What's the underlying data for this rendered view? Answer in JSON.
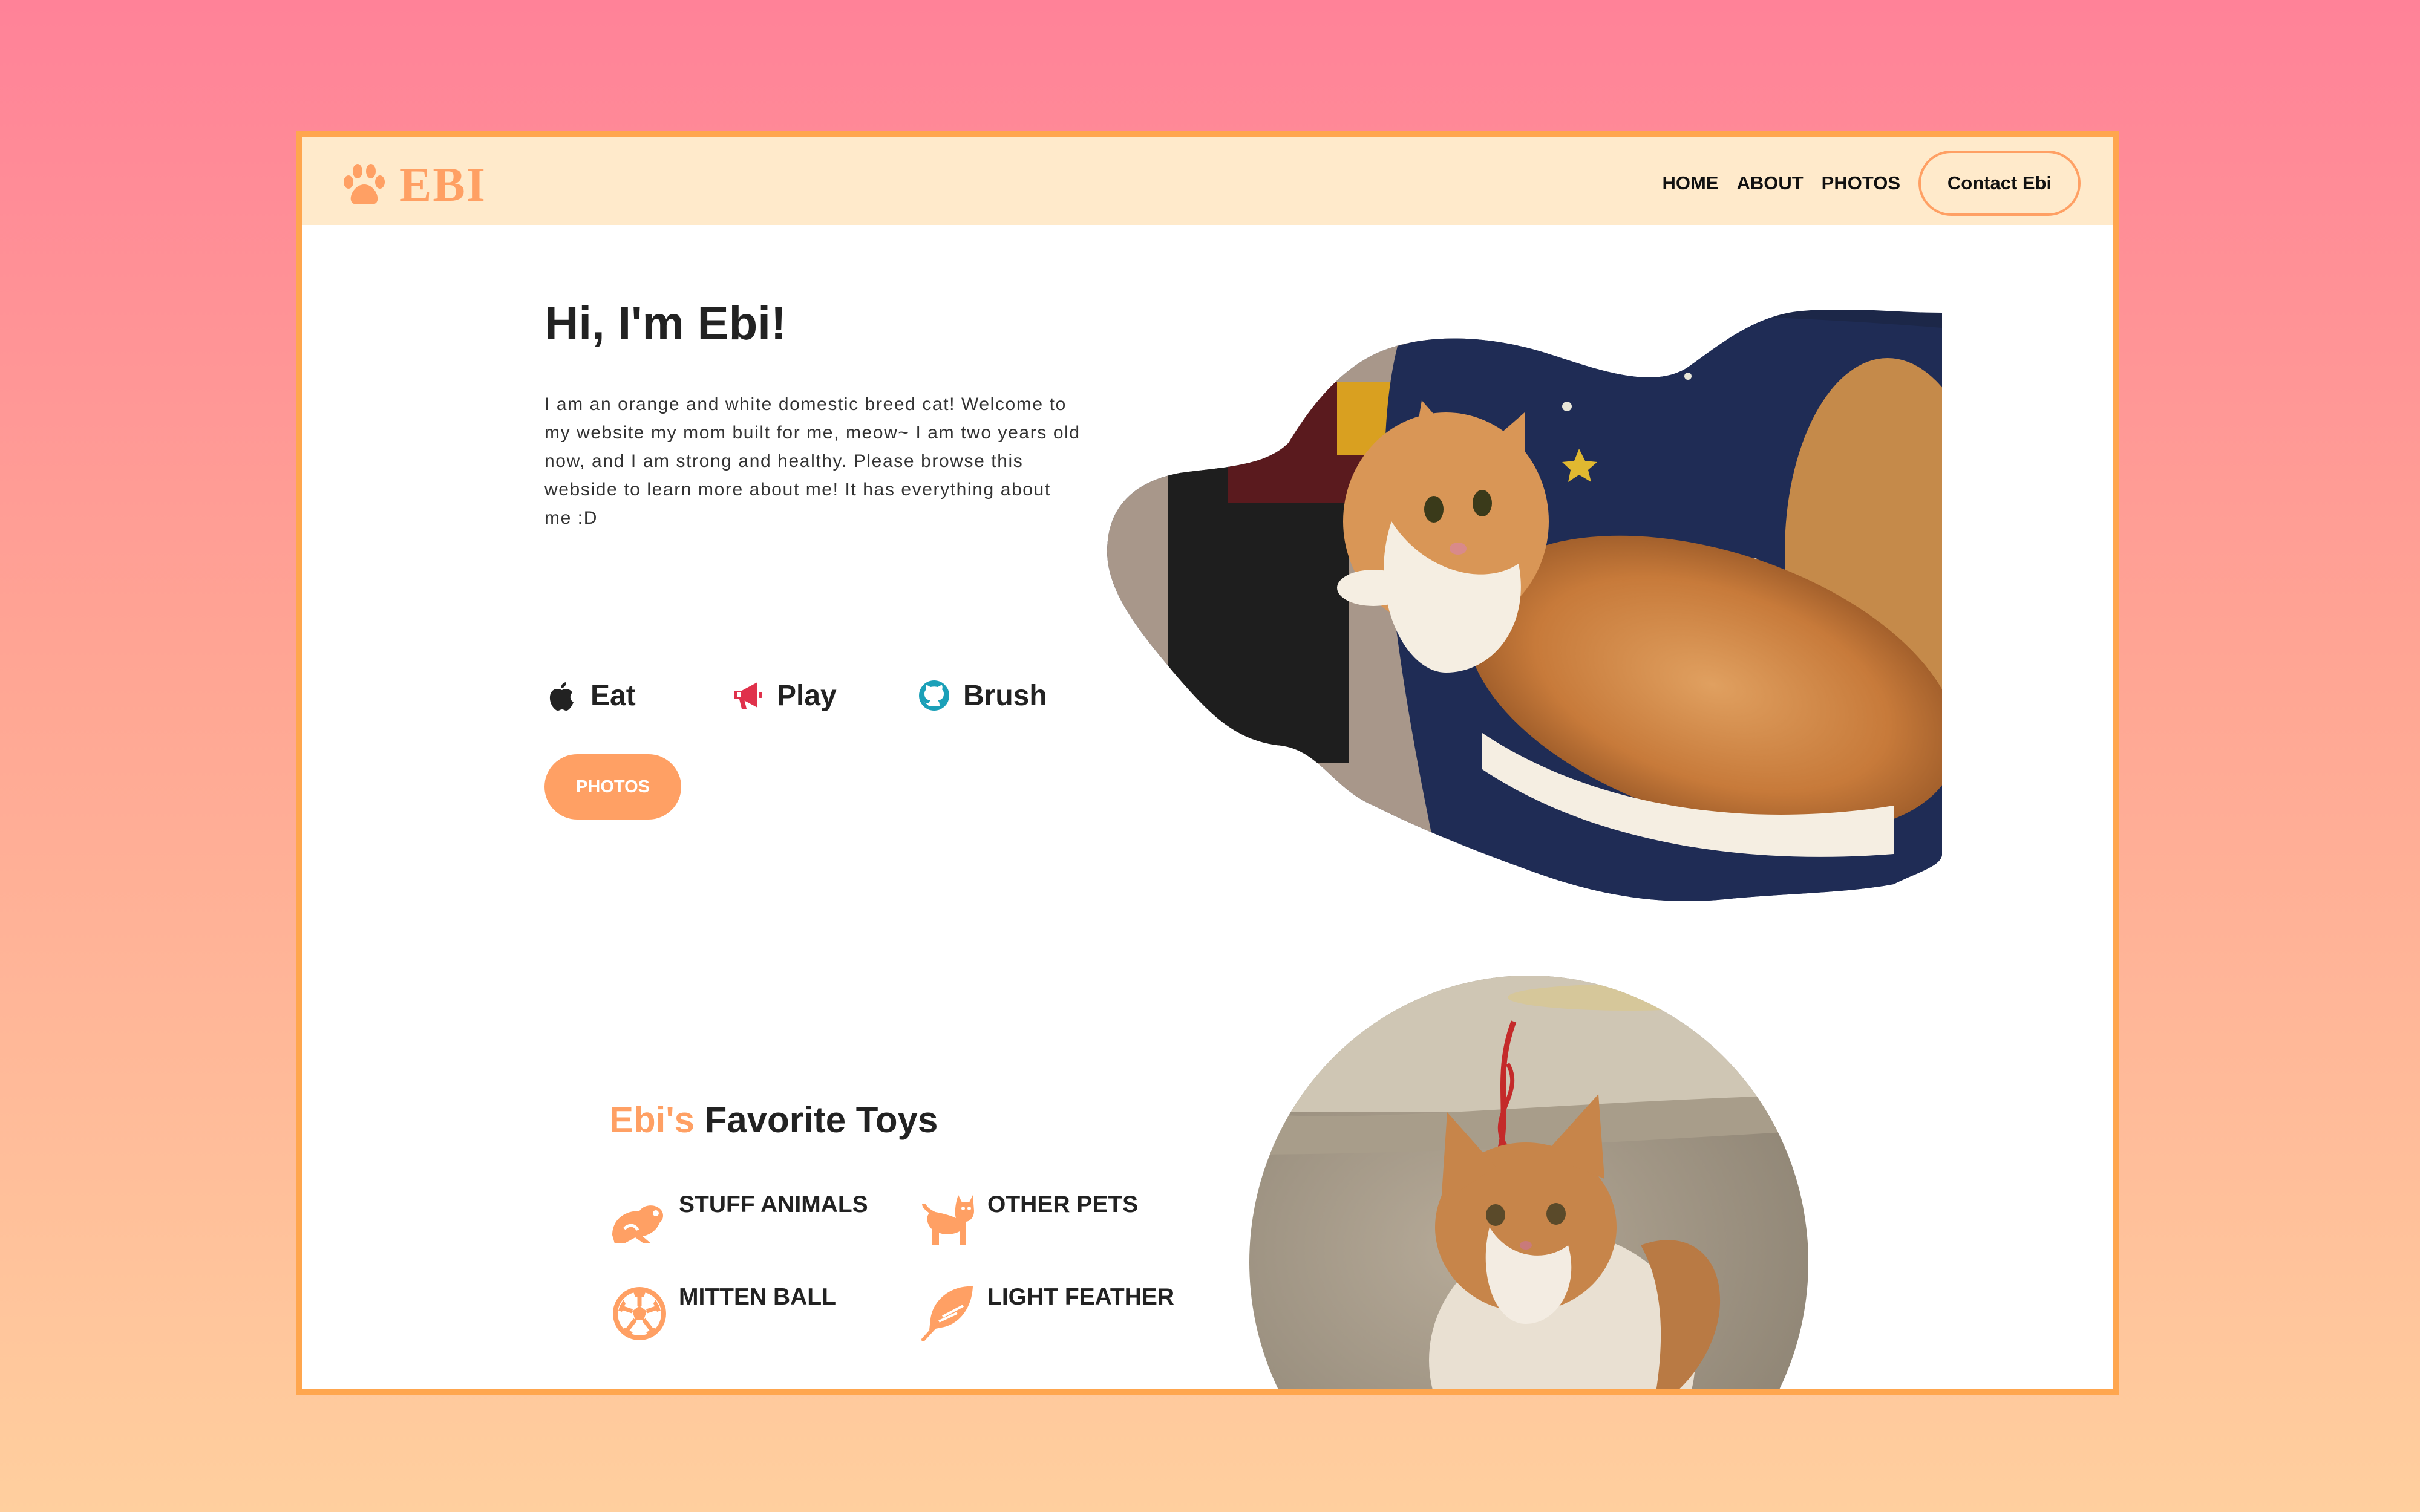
{
  "header": {
    "brand": "EBI",
    "nav": [
      "HOME",
      "ABOUT",
      "PHOTOS"
    ],
    "contact_label": "Contact Ebi"
  },
  "hero": {
    "title": "Hi, I'm Ebi!",
    "description": "I am an orange and white domestic breed cat! Welcome to my website my mom built for me, meow~ I am two years old now, and I am strong and healthy. Please browse this webside to learn more about me! It has everything about me :D",
    "activities": [
      {
        "label": "Eat",
        "icon": "apple-icon"
      },
      {
        "label": "Play",
        "icon": "megaphone-icon"
      },
      {
        "label": "Brush",
        "icon": "github-icon"
      }
    ],
    "photos_button": "PHOTOS"
  },
  "toys": {
    "title_accent": "Ebi's",
    "title_rest": " Favorite Toys",
    "items": [
      {
        "label": "STUFF ANIMALS",
        "icon": "frog-icon"
      },
      {
        "label": "OTHER PETS",
        "icon": "cat-icon"
      },
      {
        "label": "MITTEN BALL",
        "icon": "soccer-ball-icon"
      },
      {
        "label": "LIGHT FEATHER",
        "icon": "feather-icon"
      }
    ]
  },
  "colors": {
    "accent": "#ffa064",
    "frame": "#ffa64e",
    "navbar": "#ffeacb",
    "play_icon": "#e0314b",
    "brush_icon": "#1ba0b8"
  }
}
